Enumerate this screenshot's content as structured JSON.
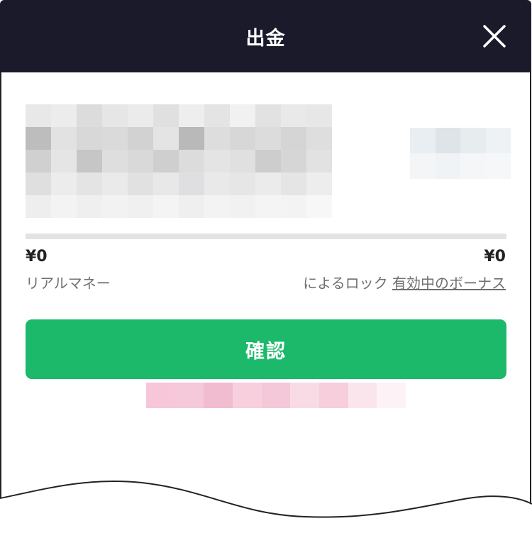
{
  "header": {
    "title": "出金",
    "close_icon": "close-icon"
  },
  "balances": {
    "real_money_amount": "¥0",
    "real_money_label": "リアルマネー",
    "locked_amount": "¥0",
    "locked_label_prefix": "によるロック",
    "active_bonus_link": "有効中のボーナス",
    "locked_fraction": 0
  },
  "actions": {
    "confirm_label": "確認"
  },
  "colors": {
    "header_bg": "#1b1a2b",
    "confirm_bg": "#1cb96b",
    "track": "#e3e3e3"
  }
}
